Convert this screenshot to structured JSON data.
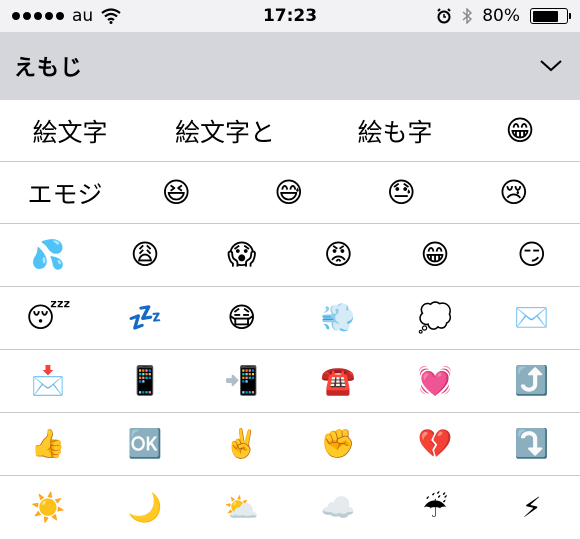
{
  "status": {
    "carrier": "au",
    "time": "17:23",
    "battery": "80%",
    "battery_level": 0.8
  },
  "header": {
    "title": "えもじ"
  },
  "row1": {
    "words": [
      "絵文字",
      "絵文字と",
      "絵も字"
    ],
    "emoji": "😁"
  },
  "row2": {
    "word": "エモジ",
    "emoji": [
      "😆",
      "😅",
      "😓",
      "😢"
    ]
  },
  "emoji_rows": [
    [
      "💦",
      "😩",
      "😱",
      "😡",
      "😁",
      "😏"
    ],
    [
      "😴",
      "💤",
      "😷",
      "💨",
      "💭",
      "✉️"
    ],
    [
      "📩",
      "📱",
      "📲",
      "☎️",
      "💓",
      "⤴️"
    ],
    [
      "👍",
      "🆗",
      "✌️",
      "✊",
      "💔",
      "⤵️"
    ],
    [
      "☀️",
      "🌙",
      "⛅",
      "☁️",
      "☔",
      "⚡"
    ]
  ]
}
